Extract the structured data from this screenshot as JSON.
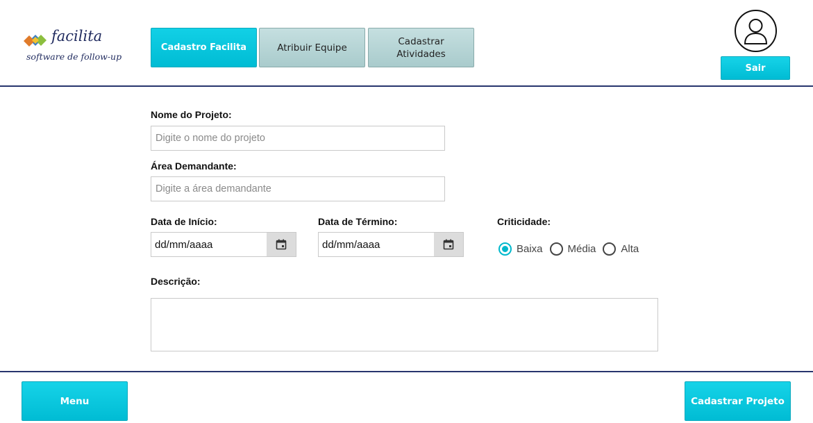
{
  "header": {
    "logo": {
      "name": "facilita",
      "tagline": "software de follow-up"
    },
    "tabs": [
      {
        "label": "Cadastro Facilita",
        "active": true
      },
      {
        "label": "Atribuir Equipe",
        "active": false
      },
      {
        "label_line1": "Cadastrar",
        "label_line2": "Atividades",
        "active": false
      }
    ],
    "user": {
      "icon": "user-icon",
      "logout_label": "Sair"
    }
  },
  "form": {
    "project_name": {
      "label": "Nome do Projeto:",
      "placeholder": "Digite o nome do projeto",
      "value": ""
    },
    "area": {
      "label": "Área Demandante:",
      "placeholder": "Digite a área demandante",
      "value": ""
    },
    "start_date": {
      "label": "Data de Início:",
      "value": "dd/mm/aaaa",
      "icon": "calendar-icon"
    },
    "end_date": {
      "label": "Data de Término:",
      "value": "dd/mm/aaaa",
      "icon": "calendar-icon"
    },
    "criticality": {
      "label": "Criticidade:",
      "options": [
        {
          "label": "Baixa",
          "checked": true
        },
        {
          "label": "Média",
          "checked": false
        },
        {
          "label": "Alta",
          "checked": false
        }
      ]
    },
    "description": {
      "label": "Descrição:",
      "value": ""
    }
  },
  "footer": {
    "menu_label": "Menu",
    "submit_label": "Cadastrar Projeto"
  },
  "colors": {
    "accent": "#00bcd4",
    "tab_idle": "#b3d3d4",
    "rule": "#27346d",
    "brand_text": "#1f2a5e"
  }
}
